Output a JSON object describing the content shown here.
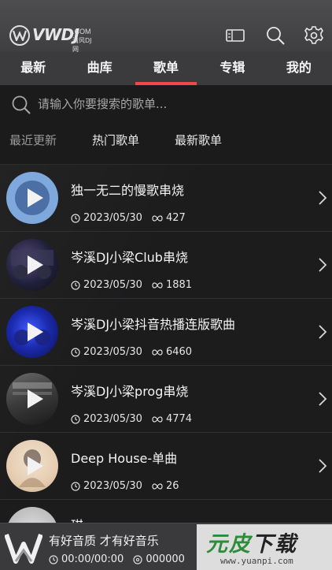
{
  "header": {
    "logo_text": "VWDJ",
    "logo_domain": ".COM",
    "logo_subtitle": "清风DJ网",
    "icons": [
      "card-icon",
      "search-icon",
      "gear-icon"
    ]
  },
  "tabs": [
    {
      "label": "最新",
      "active": false
    },
    {
      "label": "曲库",
      "active": false
    },
    {
      "label": "歌单",
      "active": true
    },
    {
      "label": "专辑",
      "active": false
    },
    {
      "label": "我的",
      "active": false
    }
  ],
  "search": {
    "placeholder": "请输入你要搜索的歌单..."
  },
  "filters": [
    {
      "label": "最近更新"
    },
    {
      "label": "热门歌单"
    },
    {
      "label": "最新歌单"
    }
  ],
  "playlists": [
    {
      "title": "独一无二的慢歌串烧",
      "date": "2023/05/30",
      "plays": "427",
      "thumb": "blue"
    },
    {
      "title": "岑溪DJ小梁Club串烧",
      "date": "2023/05/30",
      "plays": "1881",
      "thumb": "dj-deck"
    },
    {
      "title": "岑溪DJ小梁抖音热播连版歌曲",
      "date": "2023/05/30",
      "plays": "6460",
      "thumb": "blue-deck"
    },
    {
      "title": "岑溪DJ小梁prog串烧",
      "date": "2023/05/30",
      "plays": "4774",
      "thumb": "mixer"
    },
    {
      "title": "Deep House-单曲",
      "date": "2023/05/30",
      "plays": "26",
      "thumb": "girl"
    },
    {
      "title": "琪",
      "date": "",
      "plays": "",
      "thumb": "grey"
    }
  ],
  "player": {
    "title": "有好音质 才有好音乐",
    "time": "00:00/00:00",
    "plays": "000000"
  },
  "watermark": {
    "brand_green": "元皮",
    "brand_dark": "下载",
    "url": "www.yuanpi.com"
  },
  "colors": {
    "accent": "#ef4a4a",
    "header_bg": "#464648",
    "tab_bg": "#3b3b3d",
    "list_bg": "#1c1c1d",
    "play_circle": "#7da7dc"
  }
}
